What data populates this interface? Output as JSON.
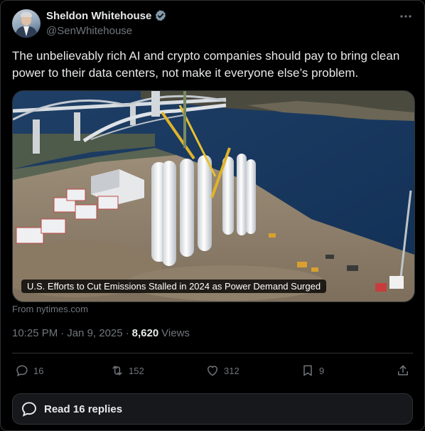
{
  "author": {
    "name": "Sheldon Whitehouse",
    "handle": "@SenWhitehouse",
    "verified": true
  },
  "tweet": {
    "text": "The unbelievably rich AI and crypto companies should pay to bring clean power to their data centers, not make it everyone else’s problem."
  },
  "media": {
    "caption": "U.S. Efforts to Cut Emissions Stalled in 2024 as Power Demand Surged",
    "source": "From nytimes.com"
  },
  "meta": {
    "time": "10:25 PM",
    "separator1": "·",
    "date": "Jan 9, 2025",
    "separator2": "·",
    "views_count": "8,620",
    "views_label": "Views"
  },
  "actions": {
    "replies": "16",
    "reposts": "152",
    "likes": "312",
    "bookmarks": "9"
  },
  "read_replies_label": "Read 16 replies",
  "colors": {
    "background": "#000000",
    "text": "#e7e9ea",
    "muted": "#71767b",
    "border": "#2f3336",
    "verified_badge": "#829aab"
  },
  "icons": [
    "more-icon",
    "verified-icon",
    "reply-icon",
    "repost-icon",
    "like-icon",
    "bookmark-icon",
    "share-icon",
    "chat-bubble-icon"
  ]
}
